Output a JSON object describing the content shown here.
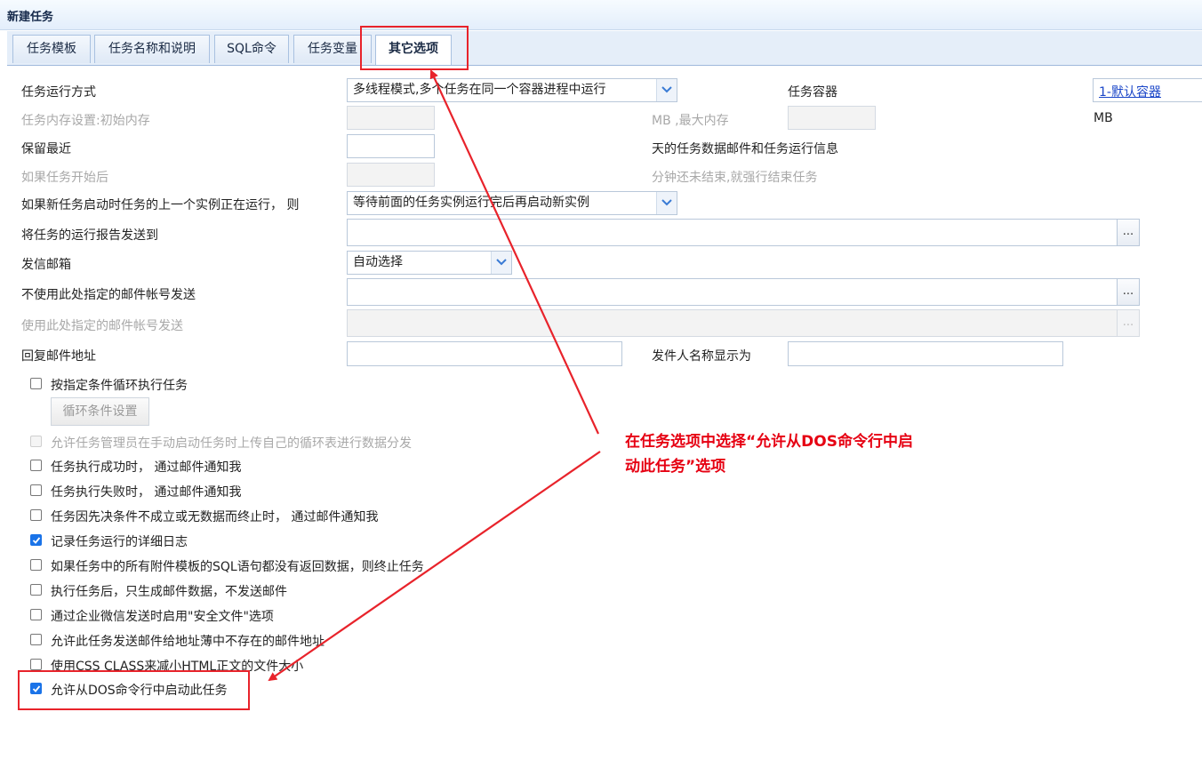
{
  "window": {
    "title": "新建任务"
  },
  "tabs": [
    {
      "label": "任务模板"
    },
    {
      "label": "任务名称和说明"
    },
    {
      "label": "SQL命令"
    },
    {
      "label": "任务变量"
    },
    {
      "label": "其它选项",
      "active": true
    }
  ],
  "form": {
    "run_mode_label": "任务运行方式",
    "run_mode_value": "多线程模式,多个任务在同一个容器进程中运行",
    "container_label": "任务容器",
    "container_value": "1-默认容器",
    "memory_label": "任务内存设置:初始内存",
    "memory_max_label": "MB ,最大内存",
    "memory_unit": "MB",
    "keep_label": "保留最近",
    "keep_suffix": "天的任务数据邮件和任务运行信息",
    "timeout_label": "如果任务开始后",
    "timeout_suffix": "分钟还未结束,就强行结束任务",
    "prev_instance_label": "如果新任务启动时任务的上一个实例正在运行， 则",
    "prev_instance_value": "等待前面的任务实例运行完后再启动新实例",
    "report_to_label": "将任务的运行报告发送到",
    "sender_box_label": "发信邮箱",
    "sender_box_value": "自动选择",
    "exclude_accounts_label": "不使用此处指定的邮件帐号发送",
    "use_accounts_label": "使用此处指定的邮件帐号发送",
    "reply_label": "回复邮件地址",
    "sender_name_label": "发件人名称显示为",
    "dots": "..."
  },
  "options": [
    {
      "label": "按指定条件循环执行任务",
      "checked": false,
      "disabled": false
    },
    {
      "label": "允许任务管理员在手动启动任务时上传自己的循环表进行数据分发",
      "checked": false,
      "disabled": true
    },
    {
      "label": "任务执行成功时， 通过邮件通知我",
      "checked": false,
      "disabled": false
    },
    {
      "label": "任务执行失败时， 通过邮件通知我",
      "checked": false,
      "disabled": false
    },
    {
      "label": "任务因先决条件不成立或无数据而终止时， 通过邮件通知我",
      "checked": false,
      "disabled": false
    },
    {
      "label": "记录任务运行的详细日志",
      "checked": true,
      "disabled": false
    },
    {
      "label": "如果任务中的所有附件模板的SQL语句都没有返回数据，则终止任务",
      "checked": false,
      "disabled": false
    },
    {
      "label": "执行任务后，只生成邮件数据，不发送邮件",
      "checked": false,
      "disabled": false
    },
    {
      "label": "通过企业微信发送时启用\"安全文件\"选项",
      "checked": false,
      "disabled": false
    },
    {
      "label": "允许此任务发送邮件给地址薄中不存在的邮件地址",
      "checked": false,
      "disabled": false
    },
    {
      "label": "使用CSS CLASS来减小HTML正文的文件大小",
      "checked": false,
      "disabled": false
    },
    {
      "label": "允许从DOS命令行中启动此任务",
      "checked": true,
      "disabled": false
    }
  ],
  "loop_settings_button": "循环条件设置",
  "annotation": {
    "line1": "在任务选项中选择“允许从DOS命令行中启",
    "line2": "动此任务”选项",
    "color": "#e60012"
  }
}
